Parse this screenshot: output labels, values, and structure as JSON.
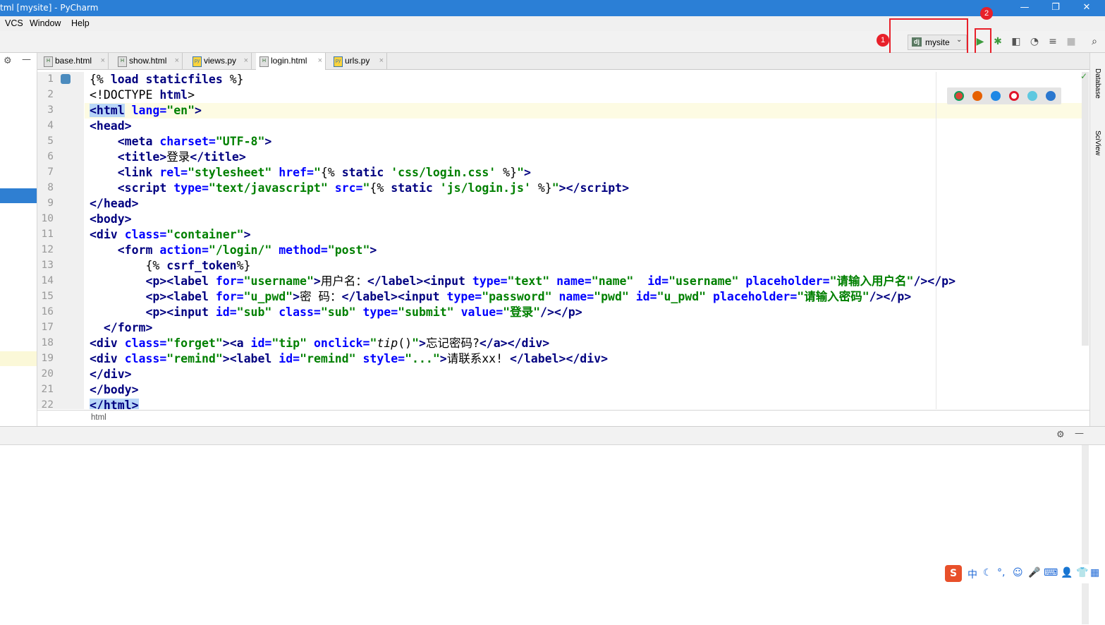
{
  "window": {
    "title": "tml [mysite] - PyCharm",
    "buttons": [
      "—",
      "❐",
      "✕"
    ]
  },
  "menu": [
    {
      "label": "VCS"
    },
    {
      "label": "Window"
    },
    {
      "label": "Help"
    }
  ],
  "run_config": {
    "name": "mysite",
    "icon_text": "dj"
  },
  "annotations": {
    "badge1": "1",
    "badge2": "2"
  },
  "tabs": [
    {
      "label": "base.html",
      "icon": "H"
    },
    {
      "label": "show.html",
      "icon": "H"
    },
    {
      "label": "views.py",
      "icon": "py"
    },
    {
      "label": "login.html",
      "icon": "H"
    },
    {
      "label": "urls.py",
      "icon": "py"
    }
  ],
  "active_tab": "login.html",
  "close_glyph": "×",
  "line_numbers": [
    "1",
    "2",
    "3",
    "4",
    "5",
    "6",
    "7",
    "8",
    "9",
    "10",
    "11",
    "12",
    "13",
    "14",
    "15",
    "16",
    "17",
    "18",
    "19",
    "20",
    "21",
    "22"
  ],
  "breadcrumb": "html",
  "side_tools": {
    "database": "Database",
    "sciview": "SciView"
  },
  "ime": {
    "lang": "中"
  }
}
